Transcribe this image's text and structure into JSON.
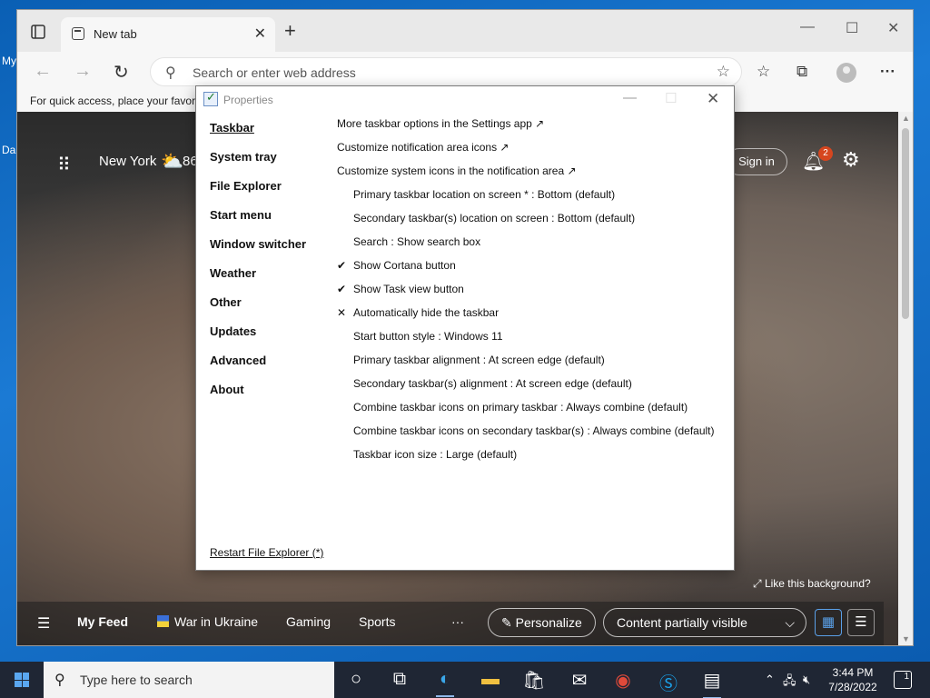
{
  "desktop": {
    "icon_labels": [
      "My",
      "Da"
    ]
  },
  "browser": {
    "tab_title": "New tab",
    "newtab_glyph": "+",
    "address_placeholder": "Search or enter web address",
    "favorites_bar_text": "For quick access, place your favori"
  },
  "newtab_page": {
    "city": "New York",
    "temperature": "86",
    "signin_label": "Sign in",
    "notification_count": "2",
    "like_background": "Like this background?",
    "feed": {
      "my_feed": "My Feed",
      "war_in_ukraine": "War in Ukraine",
      "gaming": "Gaming",
      "sports": "Sports",
      "more": "···",
      "personalize": "Personalize",
      "content_visibility": "Content partially visible"
    }
  },
  "dialog": {
    "title": "Properties",
    "sections": [
      "Taskbar",
      "System tray",
      "File Explorer",
      "Start menu",
      "Window switcher",
      "Weather",
      "Other",
      "Updates",
      "Advanced",
      "About"
    ],
    "active_section": "Taskbar",
    "options": [
      {
        "text": "More taskbar options in the Settings app ↗",
        "kind": "link",
        "mark": ""
      },
      {
        "text": "Customize notification area icons ↗",
        "kind": "link",
        "mark": ""
      },
      {
        "text": "Customize system icons in the notification area ↗",
        "kind": "link",
        "mark": ""
      },
      {
        "text": "Primary taskbar location on screen * : Bottom (default)",
        "kind": "sub",
        "mark": ""
      },
      {
        "text": "Secondary taskbar(s) location on screen : Bottom (default)",
        "kind": "sub",
        "mark": ""
      },
      {
        "text": "Search : Show search box",
        "kind": "sub",
        "mark": ""
      },
      {
        "text": "Show Cortana button",
        "kind": "sub",
        "mark": "✔"
      },
      {
        "text": "Show Task view button",
        "kind": "sub",
        "mark": "✔"
      },
      {
        "text": "Automatically hide the taskbar",
        "kind": "sub",
        "mark": "✕"
      },
      {
        "text": "Start button style : Windows 11",
        "kind": "sub",
        "mark": ""
      },
      {
        "text": "Primary taskbar alignment : At screen edge (default)",
        "kind": "sub",
        "mark": ""
      },
      {
        "text": "Secondary taskbar(s) alignment : At screen edge (default)",
        "kind": "sub",
        "mark": ""
      },
      {
        "text": "Combine taskbar icons on primary taskbar : Always combine (default)",
        "kind": "sub",
        "mark": ""
      },
      {
        "text": "Combine taskbar icons on secondary taskbar(s) : Always combine (default)",
        "kind": "sub",
        "mark": ""
      },
      {
        "text": "Taskbar icon size : Large (default)",
        "kind": "sub",
        "mark": ""
      }
    ],
    "restart_link": "Restart File Explorer (*)"
  },
  "taskbar": {
    "search_placeholder": "Type here to search",
    "time": "3:44 PM",
    "date": "7/28/2022",
    "notification_count": "1"
  }
}
